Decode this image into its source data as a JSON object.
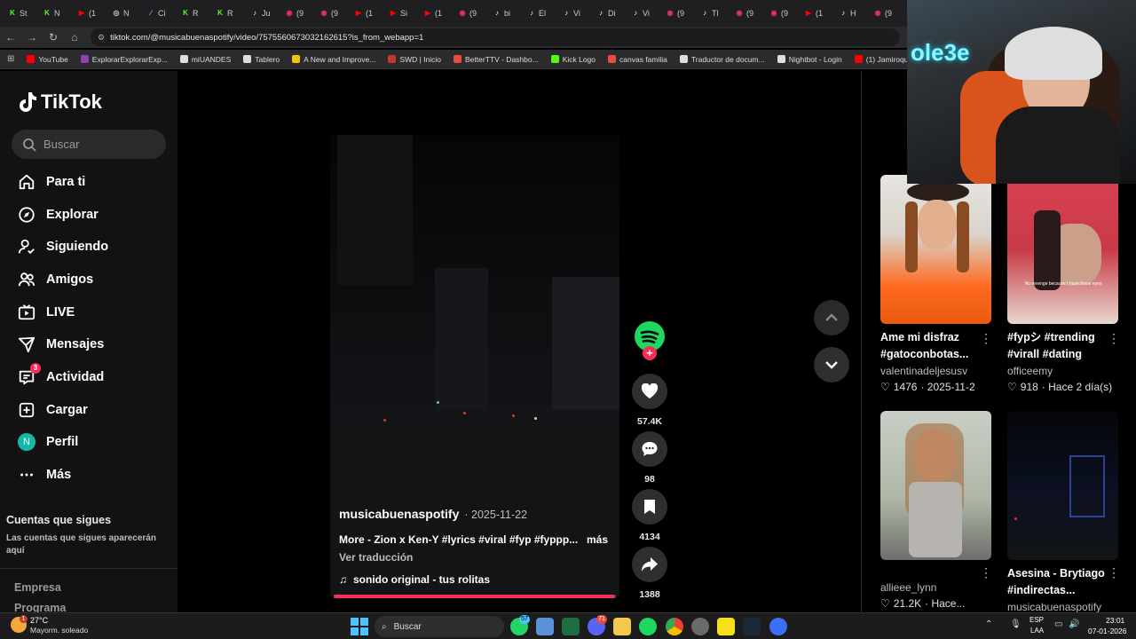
{
  "browser": {
    "tabs": [
      {
        "label": "St",
        "color": "#53fc18",
        "ch": "K"
      },
      {
        "label": "N",
        "color": "#53fc18",
        "ch": "K"
      },
      {
        "label": "(1",
        "color": "#ff0000",
        "ch": "▶"
      },
      {
        "label": "N",
        "color": "#cccccc",
        "ch": "◎"
      },
      {
        "label": "Ci",
        "color": "#c58cff",
        "ch": "∕"
      },
      {
        "label": "R",
        "color": "#53fc18",
        "ch": "K"
      },
      {
        "label": "R",
        "color": "#53fc18",
        "ch": "K"
      },
      {
        "label": "Ju",
        "color": "#ffffff",
        "ch": "♪"
      },
      {
        "label": "(9",
        "color": "#e1306c",
        "ch": "◉"
      },
      {
        "label": "(9",
        "color": "#e1306c",
        "ch": "◉"
      },
      {
        "label": "(1",
        "color": "#ff0000",
        "ch": "▶"
      },
      {
        "label": "Si",
        "color": "#ff0000",
        "ch": "▶"
      },
      {
        "label": "(1",
        "color": "#ff0000",
        "ch": "▶"
      },
      {
        "label": "(9",
        "color": "#e1306c",
        "ch": "◉"
      },
      {
        "label": "bi",
        "color": "#ffffff",
        "ch": "♪"
      },
      {
        "label": "El",
        "color": "#ffffff",
        "ch": "♪"
      },
      {
        "label": "Vi",
        "color": "#ffffff",
        "ch": "♪"
      },
      {
        "label": "Di",
        "color": "#ffffff",
        "ch": "♪"
      },
      {
        "label": "Vi",
        "color": "#ffffff",
        "ch": "♪"
      },
      {
        "label": "(9",
        "color": "#e1306c",
        "ch": "◉"
      },
      {
        "label": "Tl",
        "color": "#ffffff",
        "ch": "♪"
      },
      {
        "label": "(9",
        "color": "#e1306c",
        "ch": "◉"
      },
      {
        "label": "(9",
        "color": "#e1306c",
        "ch": "◉"
      },
      {
        "label": "(1",
        "color": "#ff0000",
        "ch": "▶"
      },
      {
        "label": "H",
        "color": "#ffffff",
        "ch": "♪"
      },
      {
        "label": "(9",
        "color": "#e1306c",
        "ch": "◉"
      }
    ],
    "url": "tiktok.com/@musicabuenaspotify/video/7575560673032162615?is_from_webapp=1",
    "bookmarks": [
      {
        "label": "YouTube",
        "color": "#ff0000"
      },
      {
        "label": "ExplorarExplorarExp...",
        "color": "#8e44ad"
      },
      {
        "label": "miUANDES",
        "color": "#dddddd"
      },
      {
        "label": "Tablero",
        "color": "#dddddd"
      },
      {
        "label": "A New and Improve...",
        "color": "#f1c40f"
      },
      {
        "label": "SWD | Inicio",
        "color": "#c0392b"
      },
      {
        "label": "BetterTTV - Dashbo...",
        "color": "#e74c3c"
      },
      {
        "label": "Kick Logo",
        "color": "#53fc18"
      },
      {
        "label": "canvas familia",
        "color": "#e74c3c"
      },
      {
        "label": "Traductor de docum...",
        "color": "#dddddd"
      },
      {
        "label": "Nightbot - Login",
        "color": "#dddddd"
      },
      {
        "label": "(1) Jamiroquai - Can...",
        "color": "#ff0000"
      }
    ]
  },
  "sidebar": {
    "logo": "TikTok",
    "search_placeholder": "Buscar",
    "nav": [
      {
        "label": "Para ti",
        "icon": "home-icon"
      },
      {
        "label": "Explorar",
        "icon": "compass-icon"
      },
      {
        "label": "Siguiendo",
        "icon": "following-icon"
      },
      {
        "label": "Amigos",
        "icon": "friends-icon"
      },
      {
        "label": "LIVE",
        "icon": "live-icon"
      },
      {
        "label": "Mensajes",
        "icon": "messages-icon"
      },
      {
        "label": "Actividad",
        "icon": "activity-icon",
        "badge": "3"
      },
      {
        "label": "Cargar",
        "icon": "upload-icon"
      },
      {
        "label": "Perfil",
        "icon": "avatar",
        "avatar": "N"
      },
      {
        "label": "Más",
        "icon": "more-icon"
      }
    ],
    "following_title": "Cuentas que sigues",
    "following_text": "Las cuentas que sigues aparecerán aquí",
    "footer": [
      "Empresa",
      "Programa"
    ]
  },
  "video": {
    "author": "musicabuenaspotify",
    "date": "· 2025-11-22",
    "caption": "More - Zion x Ken-Y #lyrics #viral #fyp #fyppp...",
    "more": "más",
    "translate": "Ver traducción",
    "sound": "sonido original - tus rolitas",
    "progress": 0.995,
    "likes": "57.4K",
    "comments": "98",
    "saves": "4134",
    "shares": "1388"
  },
  "related": [
    {
      "title": "Ame mi disfraz #gatoconbotas...",
      "user": "valentinadeljesusv",
      "likes": "1476",
      "extra": "· 2025-11-2"
    },
    {
      "title": "#fypシ #trending #virall #dating",
      "user": "officeemy",
      "likes": "918",
      "extra": "· Hace 2 día(s)",
      "overlay": "No revenge because I have these eyes"
    },
    {
      "title": "",
      "user": "allieee_lynn",
      "likes": "21.2K",
      "extra": "· Hace..."
    },
    {
      "title": "Asesina - Brytiago #indirectas...",
      "user": "musicabuenaspotify",
      "likes": "",
      "extra": ""
    }
  ],
  "webcam": {
    "overlay": "ole3e"
  },
  "taskbar": {
    "weather_temp": "27°C",
    "weather_desc": "Mayorm. soleado",
    "weather_badge": "1",
    "search": "Buscar",
    "lang": "ESP",
    "lang2": "LAA",
    "time": "23:01",
    "date": "07-01-2026",
    "badge_whatsapp": "57",
    "badge_discord": "71"
  }
}
